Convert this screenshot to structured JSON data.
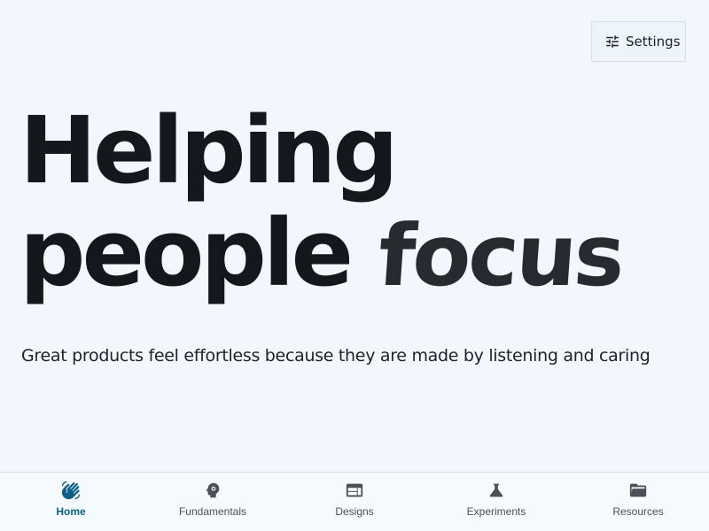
{
  "header": {
    "settings_label": "Settings",
    "settings_icon": "tune-icon"
  },
  "hero": {
    "title_line1": "Helping",
    "title_line2_word1": "people",
    "title_line2_word2": "focus",
    "subtitle": "Great products feel effortless because they are made by listening and caring"
  },
  "nav": {
    "active_color": "#0d5f86",
    "inactive_color": "#4a5258",
    "items": [
      {
        "label": "Home",
        "icon": "waving-hand-icon",
        "active": true
      },
      {
        "label": "Fundamentals",
        "icon": "psychology-icon",
        "active": false
      },
      {
        "label": "Designs",
        "icon": "web-layout-icon",
        "active": false
      },
      {
        "label": "Experiments",
        "icon": "science-flask-icon",
        "active": false
      },
      {
        "label": "Resources",
        "icon": "folder-open-icon",
        "active": false
      }
    ]
  }
}
